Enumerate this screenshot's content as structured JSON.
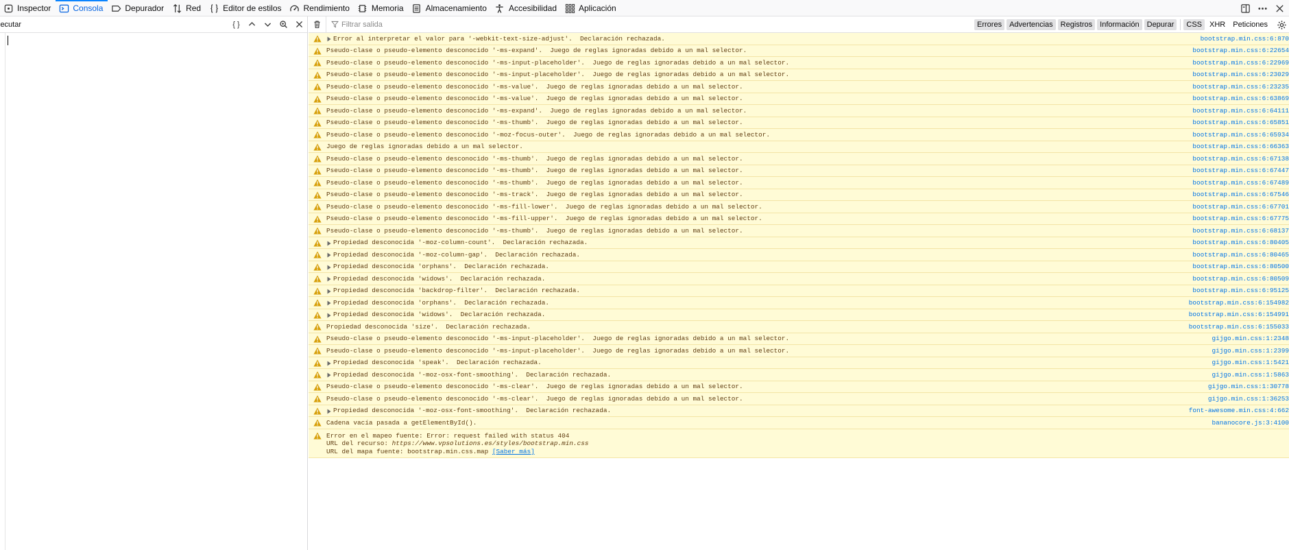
{
  "toolbar": {
    "tabs": [
      {
        "label": "Inspector",
        "icon": "inspector-icon",
        "active": false
      },
      {
        "label": "Consola",
        "icon": "console-icon",
        "active": true
      },
      {
        "label": "Depurador",
        "icon": "debugger-icon",
        "active": false
      },
      {
        "label": "Red",
        "icon": "network-icon",
        "active": false
      },
      {
        "label": "Editor de estilos",
        "icon": "style-editor-icon",
        "active": false
      },
      {
        "label": "Rendimiento",
        "icon": "performance-icon",
        "active": false
      },
      {
        "label": "Memoria",
        "icon": "memory-icon",
        "active": false
      },
      {
        "label": "Almacenamiento",
        "icon": "storage-icon",
        "active": false
      },
      {
        "label": "Accesibilidad",
        "icon": "accessibility-icon",
        "active": false
      },
      {
        "label": "Aplicación",
        "icon": "application-icon",
        "active": false
      }
    ],
    "right_icons": [
      "dock-icon",
      "more-icon",
      "close-icon"
    ]
  },
  "editor": {
    "execute_label": "jecutar",
    "pretty_label": "{ }",
    "icons": [
      "chevron-up-icon",
      "chevron-down-icon",
      "search-icon",
      "close-icon"
    ]
  },
  "console": {
    "filter_placeholder": "Filtrar salida",
    "filters": [
      {
        "label": "Errores",
        "on": true
      },
      {
        "label": "Advertencias",
        "on": true
      },
      {
        "label": "Registros",
        "on": true
      },
      {
        "label": "Información",
        "on": true
      },
      {
        "label": "Depurar",
        "on": true
      }
    ],
    "extra_filters": [
      {
        "label": "CSS",
        "on": true
      },
      {
        "label": "XHR",
        "on": false
      },
      {
        "label": "Peticiones",
        "on": false
      }
    ],
    "colors": {
      "warning_bg": "#fffbd6",
      "warning_text": "#5f3b0f",
      "link": "#0074e8",
      "active_tab": "#0060df"
    },
    "messages": [
      {
        "text": "Error al interpretar el valor para '-webkit-text-size-adjust'.  Declaración rechazada.",
        "loc": "bootstrap.min.css:6:870",
        "expandable": true
      },
      {
        "text": "Pseudo-clase o pseudo-elemento desconocido '-ms-expand'.  Juego de reglas ignoradas debido a un mal selector.",
        "loc": "bootstrap.min.css:6:22654",
        "expandable": false
      },
      {
        "text": "Pseudo-clase o pseudo-elemento desconocido '-ms-input-placeholder'.  Juego de reglas ignoradas debido a un mal selector.",
        "loc": "bootstrap.min.css:6:22969",
        "expandable": false
      },
      {
        "text": "Pseudo-clase o pseudo-elemento desconocido '-ms-input-placeholder'.  Juego de reglas ignoradas debido a un mal selector.",
        "loc": "bootstrap.min.css:6:23029",
        "expandable": false
      },
      {
        "text": "Pseudo-clase o pseudo-elemento desconocido '-ms-value'.  Juego de reglas ignoradas debido a un mal selector.",
        "loc": "bootstrap.min.css:6:23235",
        "expandable": false
      },
      {
        "text": "Pseudo-clase o pseudo-elemento desconocido '-ms-value'.  Juego de reglas ignoradas debido a un mal selector.",
        "loc": "bootstrap.min.css:6:63869",
        "expandable": false
      },
      {
        "text": "Pseudo-clase o pseudo-elemento desconocido '-ms-expand'.  Juego de reglas ignoradas debido a un mal selector.",
        "loc": "bootstrap.min.css:6:64111",
        "expandable": false
      },
      {
        "text": "Pseudo-clase o pseudo-elemento desconocido '-ms-thumb'.  Juego de reglas ignoradas debido a un mal selector.",
        "loc": "bootstrap.min.css:6:65851",
        "expandable": false
      },
      {
        "text": "Pseudo-clase o pseudo-elemento desconocido '-moz-focus-outer'.  Juego de reglas ignoradas debido a un mal selector.",
        "loc": "bootstrap.min.css:6:65934",
        "expandable": false
      },
      {
        "text": "Juego de reglas ignoradas debido a un mal selector.",
        "loc": "bootstrap.min.css:6:66363",
        "expandable": false
      },
      {
        "text": "Pseudo-clase o pseudo-elemento desconocido '-ms-thumb'.  Juego de reglas ignoradas debido a un mal selector.",
        "loc": "bootstrap.min.css:6:67138",
        "expandable": false
      },
      {
        "text": "Pseudo-clase o pseudo-elemento desconocido '-ms-thumb'.  Juego de reglas ignoradas debido a un mal selector.",
        "loc": "bootstrap.min.css:6:67447",
        "expandable": false
      },
      {
        "text": "Pseudo-clase o pseudo-elemento desconocido '-ms-thumb'.  Juego de reglas ignoradas debido a un mal selector.",
        "loc": "bootstrap.min.css:6:67489",
        "expandable": false
      },
      {
        "text": "Pseudo-clase o pseudo-elemento desconocido '-ms-track'.  Juego de reglas ignoradas debido a un mal selector.",
        "loc": "bootstrap.min.css:6:67546",
        "expandable": false
      },
      {
        "text": "Pseudo-clase o pseudo-elemento desconocido '-ms-fill-lower'.  Juego de reglas ignoradas debido a un mal selector.",
        "loc": "bootstrap.min.css:6:67701",
        "expandable": false
      },
      {
        "text": "Pseudo-clase o pseudo-elemento desconocido '-ms-fill-upper'.  Juego de reglas ignoradas debido a un mal selector.",
        "loc": "bootstrap.min.css:6:67775",
        "expandable": false
      },
      {
        "text": "Pseudo-clase o pseudo-elemento desconocido '-ms-thumb'.  Juego de reglas ignoradas debido a un mal selector.",
        "loc": "bootstrap.min.css:6:68137",
        "expandable": false
      },
      {
        "text": "Propiedad desconocida '-moz-column-count'.  Declaración rechazada.",
        "loc": "bootstrap.min.css:6:80405",
        "expandable": true
      },
      {
        "text": "Propiedad desconocida '-moz-column-gap'.  Declaración rechazada.",
        "loc": "bootstrap.min.css:6:80465",
        "expandable": true
      },
      {
        "text": "Propiedad desconocida 'orphans'.  Declaración rechazada.",
        "loc": "bootstrap.min.css:6:80500",
        "expandable": true
      },
      {
        "text": "Propiedad desconocida 'widows'.  Declaración rechazada.",
        "loc": "bootstrap.min.css:6:80509",
        "expandable": true
      },
      {
        "text": "Propiedad desconocida 'backdrop-filter'.  Declaración rechazada.",
        "loc": "bootstrap.min.css:6:95125",
        "expandable": true
      },
      {
        "text": "Propiedad desconocida 'orphans'.  Declaración rechazada.",
        "loc": "bootstrap.min.css:6:154982",
        "expandable": true
      },
      {
        "text": "Propiedad desconocida 'widows'.  Declaración rechazada.",
        "loc": "bootstrap.min.css:6:154991",
        "expandable": true
      },
      {
        "text": "Propiedad desconocida 'size'.  Declaración rechazada.",
        "loc": "bootstrap.min.css:6:155033",
        "expandable": false
      },
      {
        "text": "Pseudo-clase o pseudo-elemento desconocido '-ms-input-placeholder'.  Juego de reglas ignoradas debido a un mal selector.",
        "loc": "gijgo.min.css:1:2348",
        "expandable": false
      },
      {
        "text": "Pseudo-clase o pseudo-elemento desconocido '-ms-input-placeholder'.  Juego de reglas ignoradas debido a un mal selector.",
        "loc": "gijgo.min.css:1:2399",
        "expandable": false
      },
      {
        "text": "Propiedad desconocida 'speak'.  Declaración rechazada.",
        "loc": "gijgo.min.css:1:5421",
        "expandable": true
      },
      {
        "text": "Propiedad desconocida '-moz-osx-font-smoothing'.  Declaración rechazada.",
        "loc": "gijgo.min.css:1:5863",
        "expandable": true
      },
      {
        "text": "Pseudo-clase o pseudo-elemento desconocido '-ms-clear'.  Juego de reglas ignoradas debido a un mal selector.",
        "loc": "gijgo.min.css:1:30778",
        "expandable": false
      },
      {
        "text": "Pseudo-clase o pseudo-elemento desconocido '-ms-clear'.  Juego de reglas ignoradas debido a un mal selector.",
        "loc": "gijgo.min.css:1:36253",
        "expandable": false
      },
      {
        "text": "Propiedad desconocida '-moz-osx-font-smoothing'.  Declaración rechazada.",
        "loc": "font-awesome.min.css:4:662",
        "expandable": true
      },
      {
        "text": "Cadena vacía pasada a getElementById().",
        "loc": "bananocore.js:3:4100",
        "expandable": false
      }
    ],
    "sourcemap_error": {
      "line1": "Error en el mapeo fuente: Error: request failed with status 404",
      "line2_prefix": "URL del recurso: ",
      "line2_url": "https://www.vpsolutions.es/styles/bootstrap.min.css",
      "line3_prefix": "URL del mapa fuente: bootstrap.min.css.map ",
      "learn_more": "[Saber más]"
    }
  }
}
